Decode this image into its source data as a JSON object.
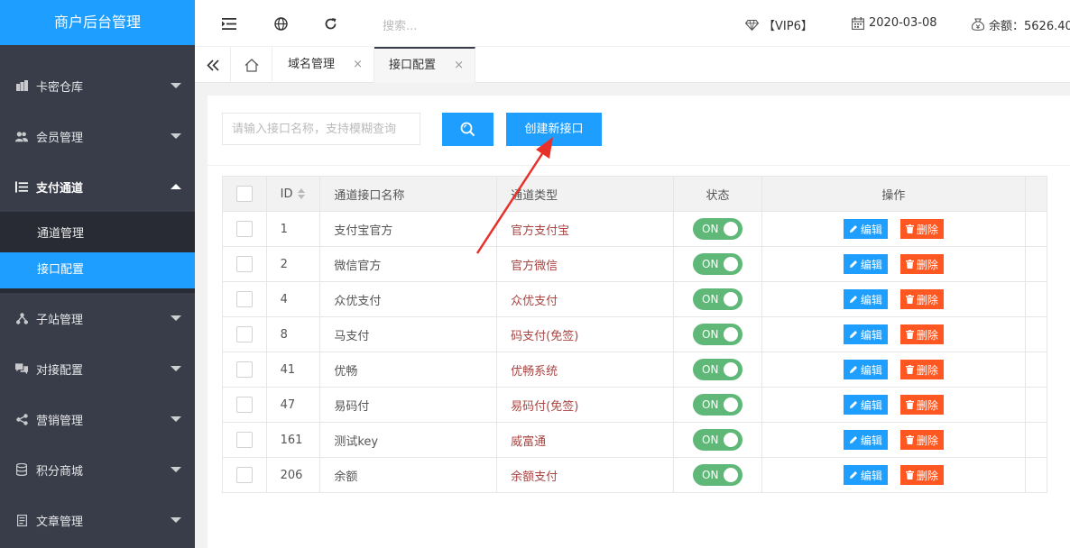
{
  "sidebar": {
    "brand": "商户后台管理",
    "items": [
      {
        "label": "卡密仓库",
        "icon": "stack-icon"
      },
      {
        "label": "会员管理",
        "icon": "users-icon"
      },
      {
        "label": "支付通道",
        "icon": "list-icon",
        "open": true
      },
      {
        "label": "子站管理",
        "icon": "sitemap-icon"
      },
      {
        "label": "对接配置",
        "icon": "chat-icon"
      },
      {
        "label": "营销管理",
        "icon": "share-icon"
      },
      {
        "label": "积分商城",
        "icon": "database-icon"
      },
      {
        "label": "文章管理",
        "icon": "document-icon"
      }
    ],
    "subitems": [
      {
        "label": "通道管理",
        "active": false
      },
      {
        "label": "接口配置",
        "active": true
      }
    ]
  },
  "header": {
    "search_placeholder": "搜索...",
    "vip": "【VIP6】",
    "date": "2020-03-08",
    "balance": "余额：5626.40"
  },
  "tabs": [
    {
      "label": "域名管理",
      "close": "×",
      "active": false
    },
    {
      "label": "接口配置",
      "close": "×",
      "active": true
    }
  ],
  "toolbar": {
    "search_placeholder": "请输入接口名称，支持模糊查询",
    "create_label": "创建新接口"
  },
  "table": {
    "columns": {
      "id": "ID",
      "name": "通道接口名称",
      "type": "通道类型",
      "status": "状态",
      "ops": "操作"
    },
    "rows": [
      {
        "id": "1",
        "name": "支付宝官方",
        "type": "官方支付宝",
        "status": "ON"
      },
      {
        "id": "2",
        "name": "微信官方",
        "type": "官方微信",
        "status": "ON"
      },
      {
        "id": "4",
        "name": "众优支付",
        "type": "众优支付",
        "status": "ON"
      },
      {
        "id": "8",
        "name": "马支付",
        "type": "码支付(免签)",
        "status": "ON"
      },
      {
        "id": "41",
        "name": "优畅",
        "type": "优畅系统",
        "status": "ON"
      },
      {
        "id": "47",
        "name": "易码付",
        "type": "易码付(免签)",
        "status": "ON"
      },
      {
        "id": "161",
        "name": "测试key",
        "type": "威富通",
        "status": "ON"
      },
      {
        "id": "206",
        "name": "余额",
        "type": "余额支付",
        "status": "ON"
      }
    ],
    "edit_label": "编辑",
    "delete_label": "删除"
  },
  "colors": {
    "brand": "#1e9fff",
    "sidebar": "#393d49",
    "switch_on": "#5fb878",
    "danger": "#ff5722",
    "type_text": "#a94442",
    "annotation_arrow": "#e8302a"
  }
}
